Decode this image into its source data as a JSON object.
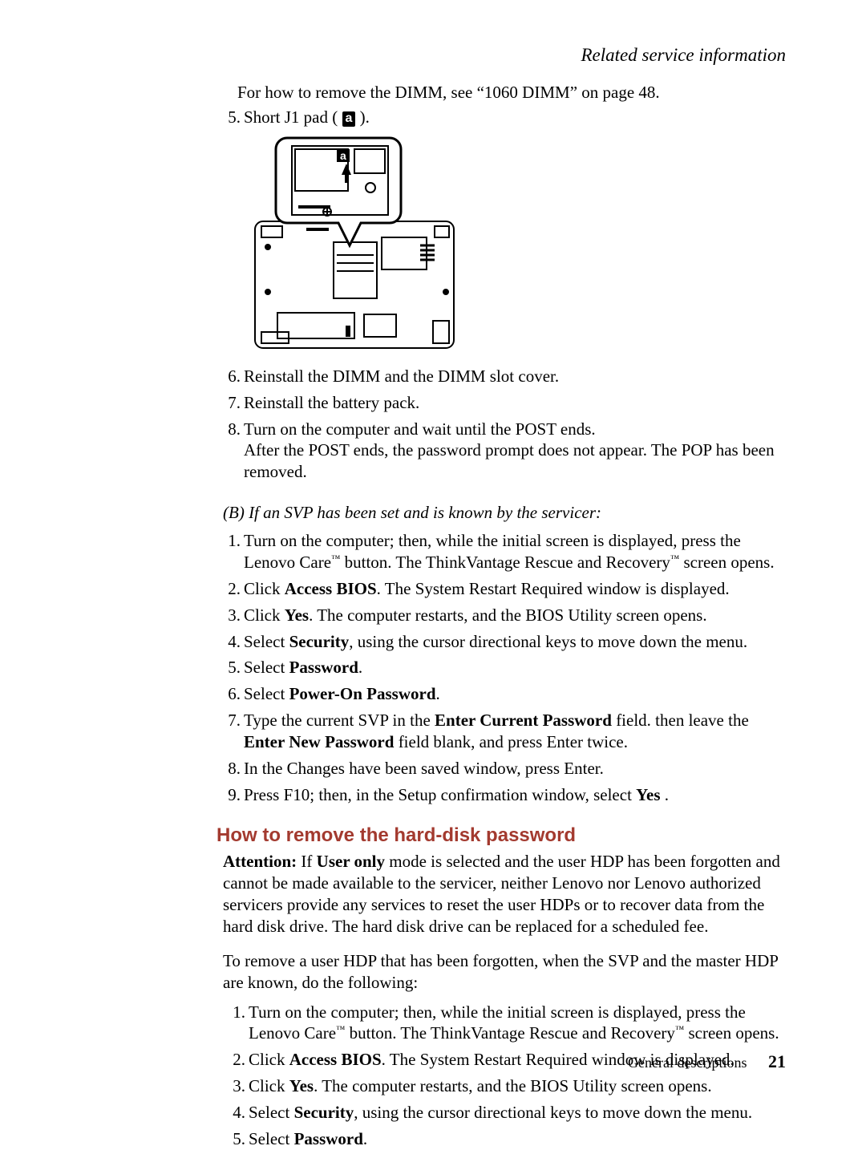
{
  "header": {
    "running": "Related service information"
  },
  "intro_line": "For how to remove the DIMM, see “1060 DIMM” on page 48.",
  "listA": {
    "item5_prefix": "Short J1 pad (",
    "item5_suffix": ").",
    "pad_label": "a",
    "item6": "Reinstall the DIMM and the DIMM slot cover.",
    "item7": "Reinstall the battery pack.",
    "item8_line1": "Turn on the computer and wait until the POST ends.",
    "item8_line2": "After the POST ends, the password prompt does not appear. The POP has been removed."
  },
  "sectionB": {
    "heading": "(B) If an SVP has been set and is known by the servicer:",
    "items": {
      "s1a": "Turn on the computer; then, while the initial screen is displayed, press the Lenovo Care",
      "s1b": " button. The ThinkVantage Rescue and Recovery",
      "s1c": " screen opens.",
      "s2a": "Click ",
      "s2b": "Access BIOS",
      "s2c": ". The System Restart Required window is displayed.",
      "s3a": "Click ",
      "s3b": "Yes",
      "s3c": ". The computer restarts, and the BIOS Utility screen opens.",
      "s4a": "Select ",
      "s4b": "Security",
      "s4c": ", using the cursor directional keys to move down the menu.",
      "s5a": "Select ",
      "s5b": "Password",
      "s5c": ".",
      "s6a": "Select ",
      "s6b": "Power-On Password",
      "s6c": ".",
      "s7a": "Type the current SVP in the ",
      "s7b": "Enter Current Password",
      "s7c": " field. then leave the ",
      "s7d": "Enter New Password",
      "s7e": " field blank, and press Enter twice.",
      "s8": "In the Changes have been saved window, press Enter.",
      "s9a": "Press F10; then, in the Setup confirmation window, select ",
      "s9b": "Yes",
      "s9c": " ."
    }
  },
  "hdp": {
    "heading": "How to remove the hard-disk password",
    "attn_label": "Attention:",
    "attn_a": "   If ",
    "attn_b": "User only",
    "attn_c": " mode is selected and the user HDP has been forgotten and cannot be made available to the servicer, neither Lenovo nor Lenovo authorized servicers provide any services to reset the user HDPs or to recover data from the hard disk drive. The hard disk drive can be replaced for a scheduled fee.",
    "lead": "To remove a user HDP that has been forgotten, when the SVP and the master HDP are known, do the following:",
    "items": {
      "h1a": "Turn on the computer; then, while the initial screen is displayed, press the Lenovo Care",
      "h1b": " button. The ThinkVantage Rescue and Recovery",
      "h1c": " screen opens.",
      "h2a": "Click ",
      "h2b": "Access BIOS",
      "h2c": ". The System Restart Required window is displayed.",
      "h3a": "Click ",
      "h3b": "Yes",
      "h3c": ". The computer restarts, and the BIOS Utility screen opens.",
      "h4a": "Select ",
      "h4b": "Security",
      "h4c": ", using the cursor directional keys to move down the menu.",
      "h5a": "Select ",
      "h5b": "Password",
      "h5c": "."
    }
  },
  "footer": {
    "section": "General descriptions",
    "page": "21"
  },
  "nums": {
    "n5": "5.",
    "n6": "6.",
    "n7": "7.",
    "n8": "8.",
    "b1": "1.",
    "b2": "2.",
    "b3": "3.",
    "b4": "4.",
    "b5": "5.",
    "b6": "6.",
    "b7": "7.",
    "b8": "8.",
    "b9": "9.",
    "c1": "1.",
    "c2": "2.",
    "c3": "3.",
    "c4": "4.",
    "c5": "5."
  },
  "tm": "™"
}
